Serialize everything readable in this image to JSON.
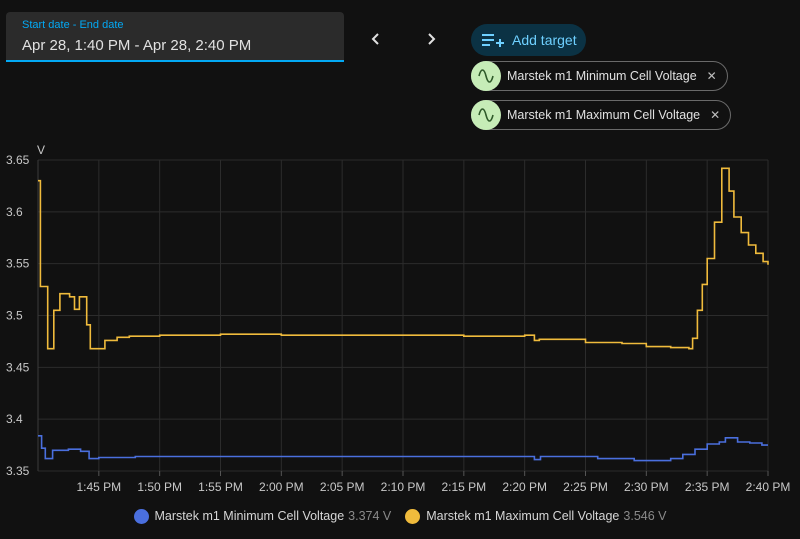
{
  "date_range": {
    "label": "Start date - End date",
    "value": "Apr 28, 1:40 PM - Apr 28, 2:40 PM"
  },
  "nav": {
    "prev_icon": "chevron-left-icon",
    "next_icon": "chevron-right-icon"
  },
  "add_target": {
    "label": "Add target",
    "icon": "playlist-plus-icon"
  },
  "targets": [
    {
      "label": "Marstek m1 Minimum Cell Voltage",
      "icon": "sine-wave-icon",
      "close": "✕"
    },
    {
      "label": "Marstek m1 Maximum Cell Voltage",
      "icon": "sine-wave-icon",
      "close": "✕"
    }
  ],
  "colors": {
    "min_series": "#4a6fde",
    "max_series": "#f0bb3c",
    "accent": "#03a9f4",
    "chip_icon_bg": "#c6ecb7"
  },
  "chart_data": {
    "type": "line",
    "step": true,
    "ylabel": "V",
    "xlim": [
      "1:40 PM",
      "2:40 PM"
    ],
    "ylim": [
      3.35,
      3.65
    ],
    "yticks": [
      "3.35",
      "3.4",
      "3.45",
      "3.5",
      "3.55",
      "3.6",
      "3.65"
    ],
    "xticks": [
      "1:45 PM",
      "1:50 PM",
      "1:55 PM",
      "2:00 PM",
      "2:05 PM",
      "2:10 PM",
      "2:15 PM",
      "2:20 PM",
      "2:25 PM",
      "2:30 PM",
      "2:35 PM",
      "2:40 PM"
    ],
    "xtick_minutes": [
      5,
      10,
      15,
      20,
      25,
      30,
      35,
      40,
      45,
      50,
      55,
      60
    ],
    "grid": true,
    "series": [
      {
        "name": "Marstek m1 Minimum Cell Voltage",
        "color": "#4a6fde",
        "points": [
          [
            0.0,
            3.384
          ],
          [
            0.3,
            3.372
          ],
          [
            0.6,
            3.362
          ],
          [
            1.2,
            3.37
          ],
          [
            2.5,
            3.371
          ],
          [
            3.5,
            3.369
          ],
          [
            4.2,
            3.362
          ],
          [
            5.0,
            3.363
          ],
          [
            8.0,
            3.364
          ],
          [
            12.0,
            3.364
          ],
          [
            18.0,
            3.364
          ],
          [
            25.0,
            3.364
          ],
          [
            30.0,
            3.364
          ],
          [
            37.0,
            3.364
          ],
          [
            40.0,
            3.364
          ],
          [
            40.8,
            3.361
          ],
          [
            41.3,
            3.364
          ],
          [
            44.0,
            3.364
          ],
          [
            46.0,
            3.362
          ],
          [
            48.0,
            3.362
          ],
          [
            49.0,
            3.36
          ],
          [
            51.0,
            3.36
          ],
          [
            52.0,
            3.362
          ],
          [
            53.0,
            3.366
          ],
          [
            54.0,
            3.371
          ],
          [
            55.0,
            3.376
          ],
          [
            56.0,
            3.378
          ],
          [
            56.5,
            3.382
          ],
          [
            57.5,
            3.378
          ],
          [
            58.5,
            3.377
          ],
          [
            59.5,
            3.375
          ],
          [
            60.0,
            3.375
          ]
        ]
      },
      {
        "name": "Marstek m1 Maximum Cell Voltage",
        "color": "#f0bb3c",
        "points": [
          [
            0.0,
            3.63
          ],
          [
            0.2,
            3.528
          ],
          [
            0.8,
            3.468
          ],
          [
            1.3,
            3.505
          ],
          [
            1.8,
            3.521
          ],
          [
            2.6,
            3.518
          ],
          [
            3.0,
            3.506
          ],
          [
            3.4,
            3.518
          ],
          [
            4.0,
            3.491
          ],
          [
            4.3,
            3.468
          ],
          [
            5.5,
            3.476
          ],
          [
            6.5,
            3.479
          ],
          [
            7.5,
            3.48
          ],
          [
            10.0,
            3.481
          ],
          [
            15.0,
            3.482
          ],
          [
            20.0,
            3.481
          ],
          [
            25.0,
            3.481
          ],
          [
            30.0,
            3.481
          ],
          [
            35.0,
            3.48
          ],
          [
            40.0,
            3.481
          ],
          [
            40.8,
            3.476
          ],
          [
            41.2,
            3.477
          ],
          [
            45.0,
            3.474
          ],
          [
            48.0,
            3.473
          ],
          [
            50.0,
            3.47
          ],
          [
            52.0,
            3.469
          ],
          [
            53.5,
            3.468
          ],
          [
            53.8,
            3.478
          ],
          [
            54.2,
            3.505
          ],
          [
            54.6,
            3.53
          ],
          [
            55.0,
            3.555
          ],
          [
            55.6,
            3.59
          ],
          [
            56.2,
            3.642
          ],
          [
            56.8,
            3.62
          ],
          [
            57.2,
            3.595
          ],
          [
            57.8,
            3.58
          ],
          [
            58.4,
            3.568
          ],
          [
            59.0,
            3.56
          ],
          [
            59.6,
            3.552
          ],
          [
            60.0,
            3.549
          ]
        ]
      }
    ]
  },
  "legend": [
    {
      "name": "Marstek m1 Minimum Cell Voltage",
      "value": "3.374 V",
      "color": "#4a6fde"
    },
    {
      "name": "Marstek m1 Maximum Cell Voltage",
      "value": "3.546 V",
      "color": "#f0bb3c"
    }
  ]
}
